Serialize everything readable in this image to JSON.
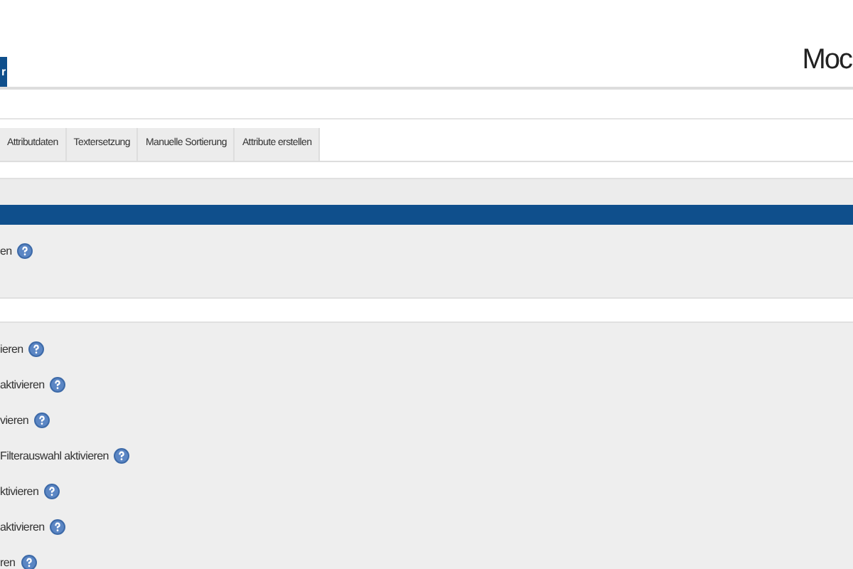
{
  "page_title": "Moc",
  "main_tabs": [
    {
      "label": "r",
      "selected": true
    }
  ],
  "sub_tabs": [
    {
      "label": "Attributdaten",
      "selected": false
    },
    {
      "label": "Textersetzung",
      "selected": false
    },
    {
      "label": "Manuelle Sortierung",
      "selected": false
    },
    {
      "label": "Attribute erstellen",
      "selected": false
    }
  ],
  "top_settings": [
    {
      "label": "en"
    }
  ],
  "settings": [
    {
      "label": "ieren"
    },
    {
      "label": "aktivieren"
    },
    {
      "label": "vieren"
    },
    {
      "label": "Filterauswahl aktivieren"
    },
    {
      "label": "ktivieren"
    },
    {
      "label": "aktivieren"
    },
    {
      "label": "ren"
    }
  ]
}
